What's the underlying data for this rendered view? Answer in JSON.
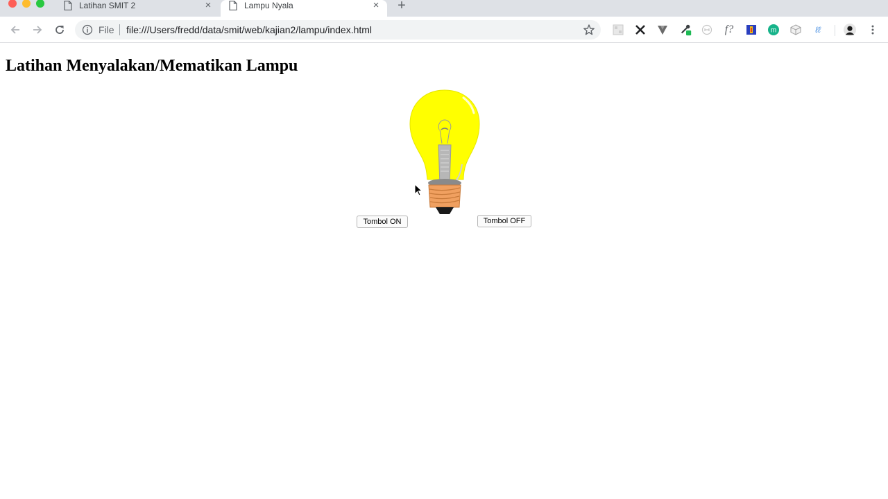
{
  "browser": {
    "tabs": [
      {
        "title": "Latihan SMIT 2",
        "active": false
      },
      {
        "title": "Lampu Nyala",
        "active": true
      }
    ],
    "new_tab": "+",
    "close": "×",
    "omnibox": {
      "scheme_label": "File",
      "url": "file:///Users/fredd/data/smit/web/kajian2/lampu/index.html"
    },
    "extensions": [
      "qr-icon",
      "x-icon",
      "v-icon",
      "eyedropper-icon",
      "link-circle-icon",
      "function-icon",
      "flag-icon",
      "m-icon",
      "cube-icon",
      "handwriting-icon"
    ]
  },
  "page": {
    "heading": "Latihan Menyalakan/Mematikan Lampu",
    "lamp_state": "on",
    "bulb_color": "#ffff00",
    "on_button": "Tombol ON",
    "off_button": "Tombol OFF"
  }
}
